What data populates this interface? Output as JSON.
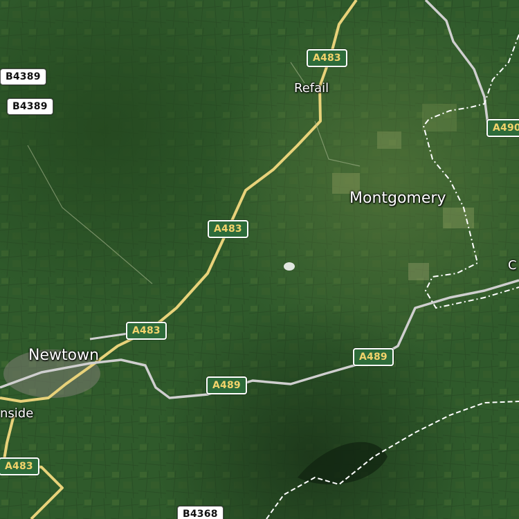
{
  "map": {
    "view": "satellite",
    "colors": {
      "terrain": "#2e5a2c",
      "primary_road": "#e8d27a",
      "secondary_road": "#c9c9c9",
      "border": "#ffffff",
      "shield_green": "#2d6b3a",
      "shield_text": "#f2d36b"
    },
    "road_shields": [
      {
        "id": "a483-top",
        "label": "A483",
        "style": "green"
      },
      {
        "id": "a483-mid",
        "label": "A483",
        "style": "green"
      },
      {
        "id": "a483-newtown",
        "label": "A483",
        "style": "green"
      },
      {
        "id": "a483-left",
        "label": "A483",
        "style": "green"
      },
      {
        "id": "a489-mid",
        "label": "A489",
        "style": "green"
      },
      {
        "id": "a489-right",
        "label": "A489",
        "style": "green"
      },
      {
        "id": "a490",
        "label": "A490",
        "style": "green"
      },
      {
        "id": "b4389-a",
        "label": "B4389",
        "style": "white"
      },
      {
        "id": "b4389-b",
        "label": "B4389",
        "style": "white"
      },
      {
        "id": "b4368",
        "label": "B4368",
        "style": "white"
      }
    ],
    "places": [
      {
        "id": "refail",
        "name": "Refail",
        "kind": "village"
      },
      {
        "id": "montgomery",
        "name": "Montgomery",
        "kind": "town"
      },
      {
        "id": "newtown",
        "name": "Newtown",
        "kind": "town"
      },
      {
        "id": "nside",
        "name": "nside",
        "kind": "cut"
      },
      {
        "id": "c-edge",
        "name": "C",
        "kind": "cut"
      }
    ]
  }
}
